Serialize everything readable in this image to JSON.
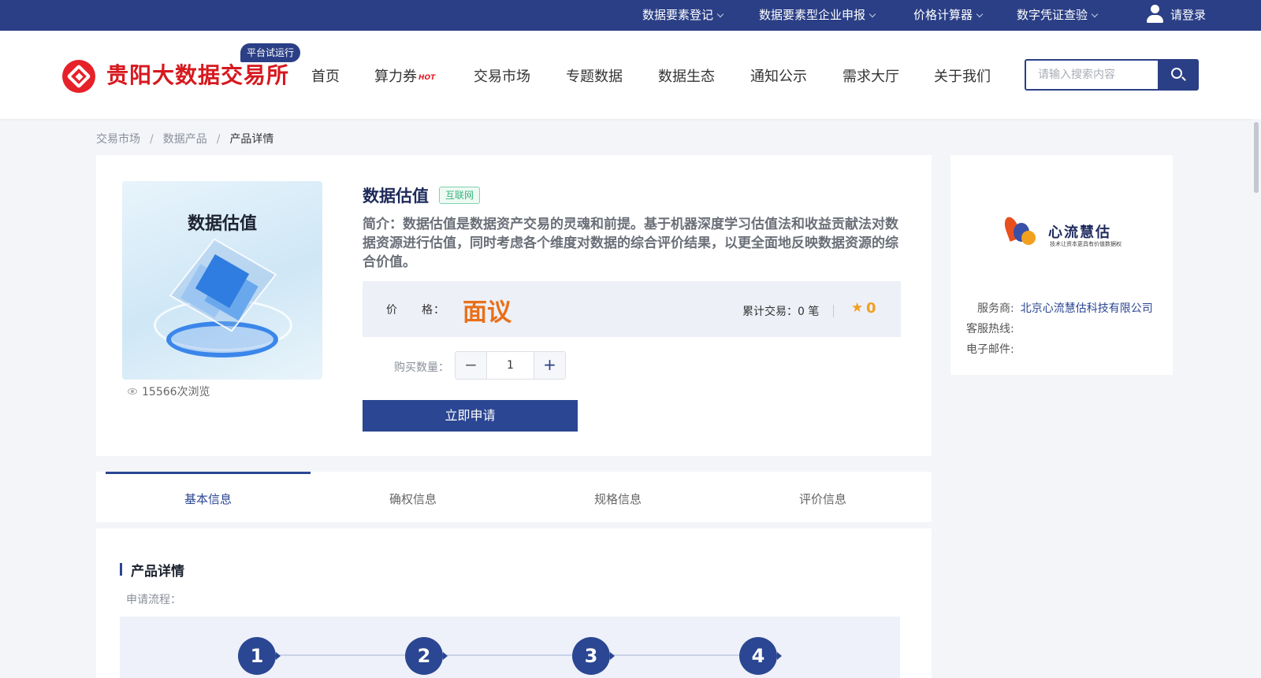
{
  "topbar": {
    "items": [
      "数据要素登记",
      "数据要素型企业申报",
      "价格计算器",
      "数字凭证查验"
    ],
    "login": "请登录"
  },
  "header": {
    "site_name": "贵阳大数据交易所",
    "trial_badge": "平台试运行",
    "nav": [
      "首页",
      "算力券",
      "交易市场",
      "专题数据",
      "数据生态",
      "通知公示",
      "需求大厅",
      "关于我们"
    ],
    "hot_label": "HOT",
    "search_placeholder": "请输入搜索内容"
  },
  "breadcrumb": [
    "交易市场",
    "数据产品",
    "产品详情"
  ],
  "product": {
    "image_title": "数据估值",
    "views": "15566次浏览",
    "title": "数据估值",
    "tag": "互联网",
    "intro": "简介：数据估值是数据资产交易的灵魂和前提。基于机器深度学习估值法和收益贡献法对数据资源进行估值，同时考虑各个维度对数据的综合评价结果，以更全面地反映数据资源的综合价值。",
    "price_label": "价　　格：",
    "price": "面议",
    "trade_count": "累计交易：0 笔",
    "rating": "0",
    "qty_label": "购买数量：",
    "qty": "1",
    "apply": "立即申请"
  },
  "vendor": {
    "logo_name": "心流慧估",
    "logo_slogan": "技术让资本更具有价值数据权",
    "provider_label": "服务商:",
    "provider": "北京心流慧估科技有限公司",
    "hotline_label": "客服热线:",
    "email_label": "电子邮件:"
  },
  "tabs": [
    "基本信息",
    "确权信息",
    "规格信息",
    "评价信息"
  ],
  "detail": {
    "title": "产品详情",
    "flow_label": "申请流程：",
    "steps": [
      "1",
      "2",
      "3",
      "4"
    ]
  },
  "colors": {
    "primary": "#2b3f86",
    "accent_price": "#e8701a",
    "brand_red": "#d6191f"
  }
}
